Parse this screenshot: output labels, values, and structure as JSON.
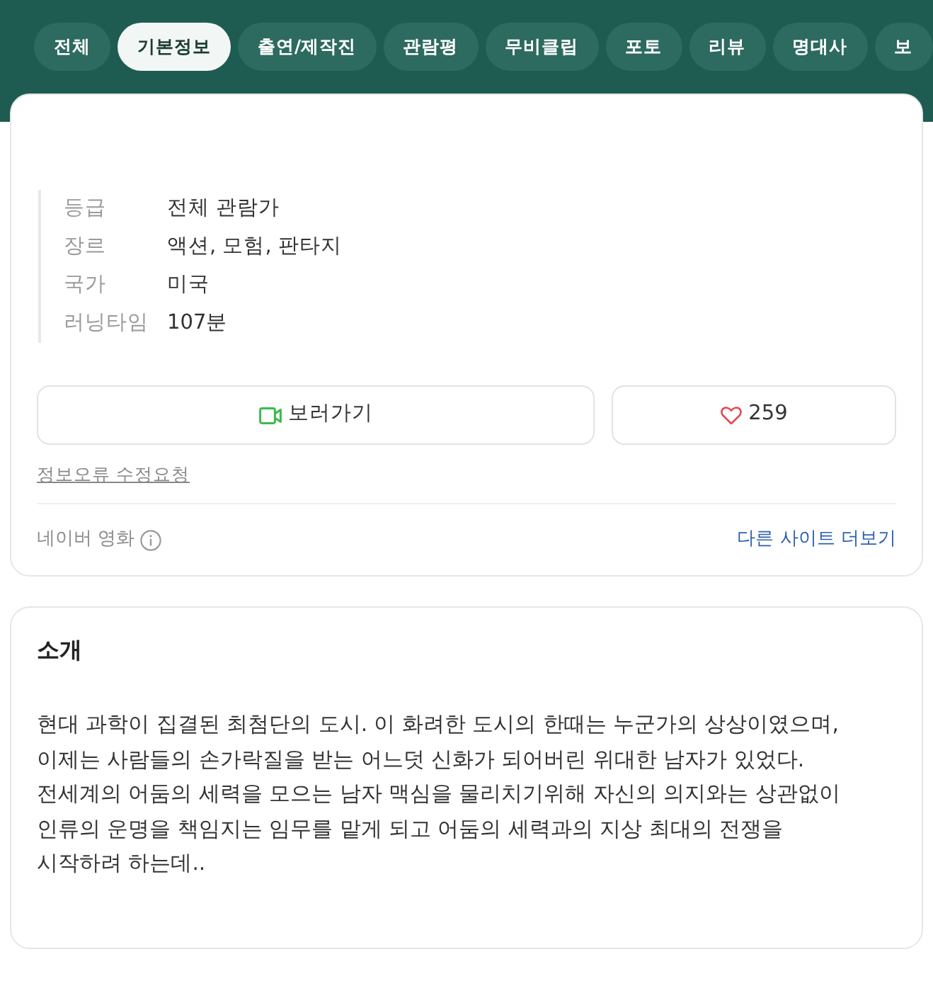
{
  "tabs": [
    {
      "label": "전체",
      "selected": false
    },
    {
      "label": "기본정보",
      "selected": true
    },
    {
      "label": "출연/제작진",
      "selected": false
    },
    {
      "label": "관람평",
      "selected": false
    },
    {
      "label": "무비클립",
      "selected": false
    },
    {
      "label": "포토",
      "selected": false
    },
    {
      "label": "리뷰",
      "selected": false
    },
    {
      "label": "명대사",
      "selected": false
    },
    {
      "label": "보",
      "selected": false
    }
  ],
  "info": [
    {
      "label": "등급",
      "value": "전체 관람가"
    },
    {
      "label": "장르",
      "value": "액션, 모험, 판타지"
    },
    {
      "label": "국가",
      "value": "미국"
    },
    {
      "label": "러닝타임",
      "value": "107분"
    }
  ],
  "actions": {
    "watch": {
      "label": "보러가기"
    },
    "like": {
      "count": "259"
    }
  },
  "report_link": "정보오류 수정요청",
  "footer": {
    "source": "네이버 영화",
    "more_link": "다른 사이트 더보기"
  },
  "intro": {
    "title": "소개",
    "text": "현대 과학이 집결된 최첨단의 도시. 이 화려한 도시의 한때는 누군가의 상상이였으며, 이제는 사람들의 손가락질을 받는 어느덧 신화가 되어버린 위대한 남자가 있었다. 전세계의 어둠의 세력을 모으는 남자 맥심을 물리치기위해 자신의 의지와는 상관없이 인류의 운명을 책임지는 임무를 맡게 되고 어둠의 세력과의 지상 최대의 전쟁을 시작하려 하는데.."
  }
}
